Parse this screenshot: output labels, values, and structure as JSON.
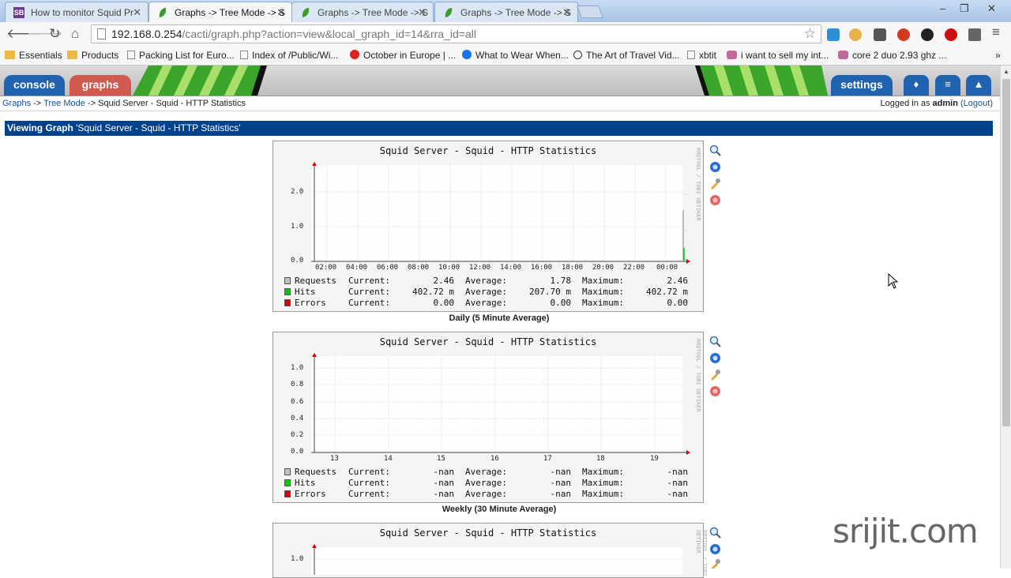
{
  "browser": {
    "tabs": [
      {
        "title": "How to monitor Squid Pr",
        "favicon_text": "SB",
        "active": false
      },
      {
        "title": "Graphs -> Tree Mode -> S",
        "active": true
      },
      {
        "title": "Graphs -> Tree Mode -> S",
        "active": false
      },
      {
        "title": "Graphs -> Tree Mode -> S",
        "active": false
      }
    ],
    "url_host": "192.168.0.254",
    "url_path": "/cacti/graph.php?action=view&local_graph_id=14&rra_id=all",
    "bookmarks": [
      {
        "label": "Essentials",
        "icon": "folder-icon"
      },
      {
        "label": "Products",
        "icon": "folder-icon"
      },
      {
        "label": "Packing List for Euro...",
        "icon": "page-icon"
      },
      {
        "label": "Index of /Public/Wi...",
        "icon": "page-icon"
      },
      {
        "label": "October in Europe | ...",
        "icon": "red-circle-icon"
      },
      {
        "label": "What to Wear When...",
        "icon": "blue-circle-icon"
      },
      {
        "label": "The Art of Travel Vid...",
        "icon": "globe-icon"
      },
      {
        "label": "xbtit",
        "icon": "page-icon"
      },
      {
        "label": "i want to sell my int...",
        "icon": "olx-icon"
      },
      {
        "label": "core 2 duo 2.93 ghz ...",
        "icon": "olx-icon"
      }
    ]
  },
  "cacti": {
    "tabs": {
      "console": "console",
      "graphs": "graphs",
      "settings": "settings"
    },
    "breadcrumb": {
      "graphs": "Graphs",
      "sep": "->",
      "tree_mode": "Tree Mode",
      "current": "Squid Server - Squid - HTTP Statistics"
    },
    "login": {
      "prefix": "Logged in as",
      "user": "admin",
      "logout": "(Logout)"
    },
    "viewing": {
      "label": "Viewing Graph",
      "name": "'Squid Server - Squid - HTTP Statistics'"
    },
    "rrdtool_text": "RRDTOOL / TOBI OETIKER"
  },
  "graphs": [
    {
      "title": "Squid Server - Squid - HTTP Statistics",
      "caption": "Daily (5 Minute Average)",
      "y_ticks": [
        "2.0",
        "1.0",
        "0.0"
      ],
      "x_ticks": [
        "02:00",
        "04:00",
        "06:00",
        "08:00",
        "10:00",
        "12:00",
        "14:00",
        "16:00",
        "18:00",
        "20:00",
        "22:00",
        "00:00"
      ],
      "legend": [
        {
          "name": "Requests",
          "color": "#c0c0c0",
          "current": "2.46",
          "average": "1.78",
          "maximum": "2.46"
        },
        {
          "name": "Hits",
          "color": "#00cc00",
          "current": "402.72 m",
          "average": "207.70 m",
          "maximum": "402.72 m"
        },
        {
          "name": "Errors",
          "color": "#dd0000",
          "current": "0.00",
          "average": "0.00",
          "maximum": "0.00"
        }
      ]
    },
    {
      "title": "Squid Server - Squid - HTTP Statistics",
      "caption": "Weekly (30 Minute Average)",
      "y_ticks": [
        "1.0",
        "0.8",
        "0.6",
        "0.4",
        "0.2",
        "0.0"
      ],
      "x_ticks": [
        "13",
        "14",
        "15",
        "16",
        "17",
        "18",
        "19"
      ],
      "legend": [
        {
          "name": "Requests",
          "color": "#c0c0c0",
          "current": "-nan",
          "average": "-nan",
          "maximum": "-nan"
        },
        {
          "name": "Hits",
          "color": "#00cc00",
          "current": "-nan",
          "average": "-nan",
          "maximum": "-nan"
        },
        {
          "name": "Errors",
          "color": "#dd0000",
          "current": "-nan",
          "average": "-nan",
          "maximum": "-nan"
        }
      ]
    },
    {
      "title": "Squid Server - Squid - HTTP Statistics",
      "y_ticks": [
        "1.0"
      ]
    }
  ],
  "labels": {
    "current": "Current:",
    "average": "Average:",
    "maximum": "Maximum:"
  },
  "watermark": "srijit.com"
}
